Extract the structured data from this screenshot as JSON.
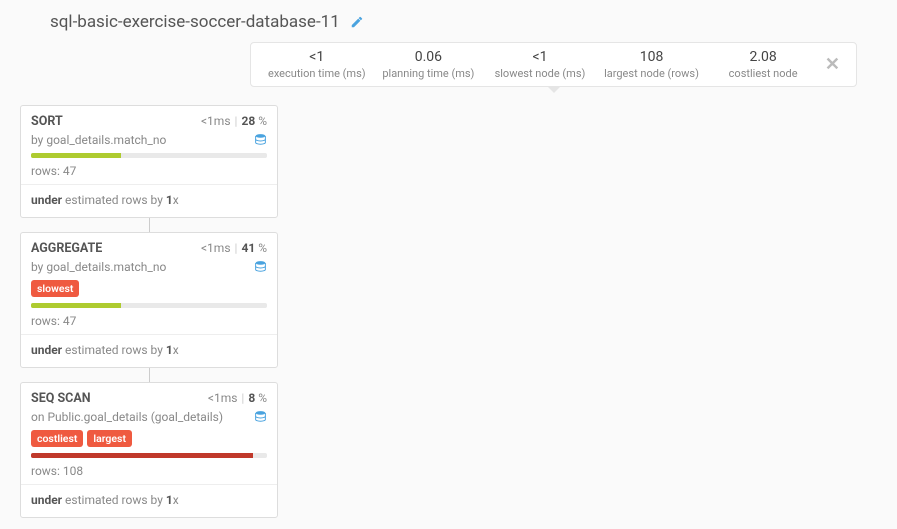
{
  "header": {
    "title": "sql-basic-exercise-soccer-database-11"
  },
  "stats": {
    "exec_val": "<1",
    "exec_label": "execution time (ms)",
    "plan_val": "0.06",
    "plan_label": "planning time (ms)",
    "slow_val": "<1",
    "slow_label": "slowest node (ms)",
    "large_val": "108",
    "large_label": "largest node (rows)",
    "cost_val": "2.08",
    "cost_label": "costliest node"
  },
  "nodes": {
    "sort": {
      "title": "SORT",
      "ms": "<1",
      "ms_unit": "ms",
      "pct": "28",
      "pct_sign": " %",
      "by_prefix": "by ",
      "by": "goal_details.match_no",
      "rows_prefix": "rows: ",
      "rows": "47",
      "est_bold1": "under",
      "est_mid": " estimated rows by ",
      "est_bold2": "1",
      "est_suffix": "x"
    },
    "agg": {
      "title": "AGGREGATE",
      "ms": "<1",
      "ms_unit": "ms",
      "pct": "41",
      "pct_sign": " %",
      "by_prefix": "by ",
      "by": "goal_details.match_no",
      "tag_slowest": "slowest",
      "rows_prefix": "rows: ",
      "rows": "47",
      "est_bold1": "under",
      "est_mid": " estimated rows by ",
      "est_bold2": "1",
      "est_suffix": "x"
    },
    "seq": {
      "title": "SEQ SCAN",
      "ms": "<1",
      "ms_unit": "ms",
      "pct": "8",
      "pct_sign": " %",
      "by_prefix": "on ",
      "by": "Public.goal_details (goal_details)",
      "tag_costliest": "costliest",
      "tag_largest": "largest",
      "rows_prefix": "rows: ",
      "rows": "108",
      "est_bold1": "under",
      "est_mid": " estimated rows by ",
      "est_bold2": "1",
      "est_suffix": "x"
    }
  }
}
